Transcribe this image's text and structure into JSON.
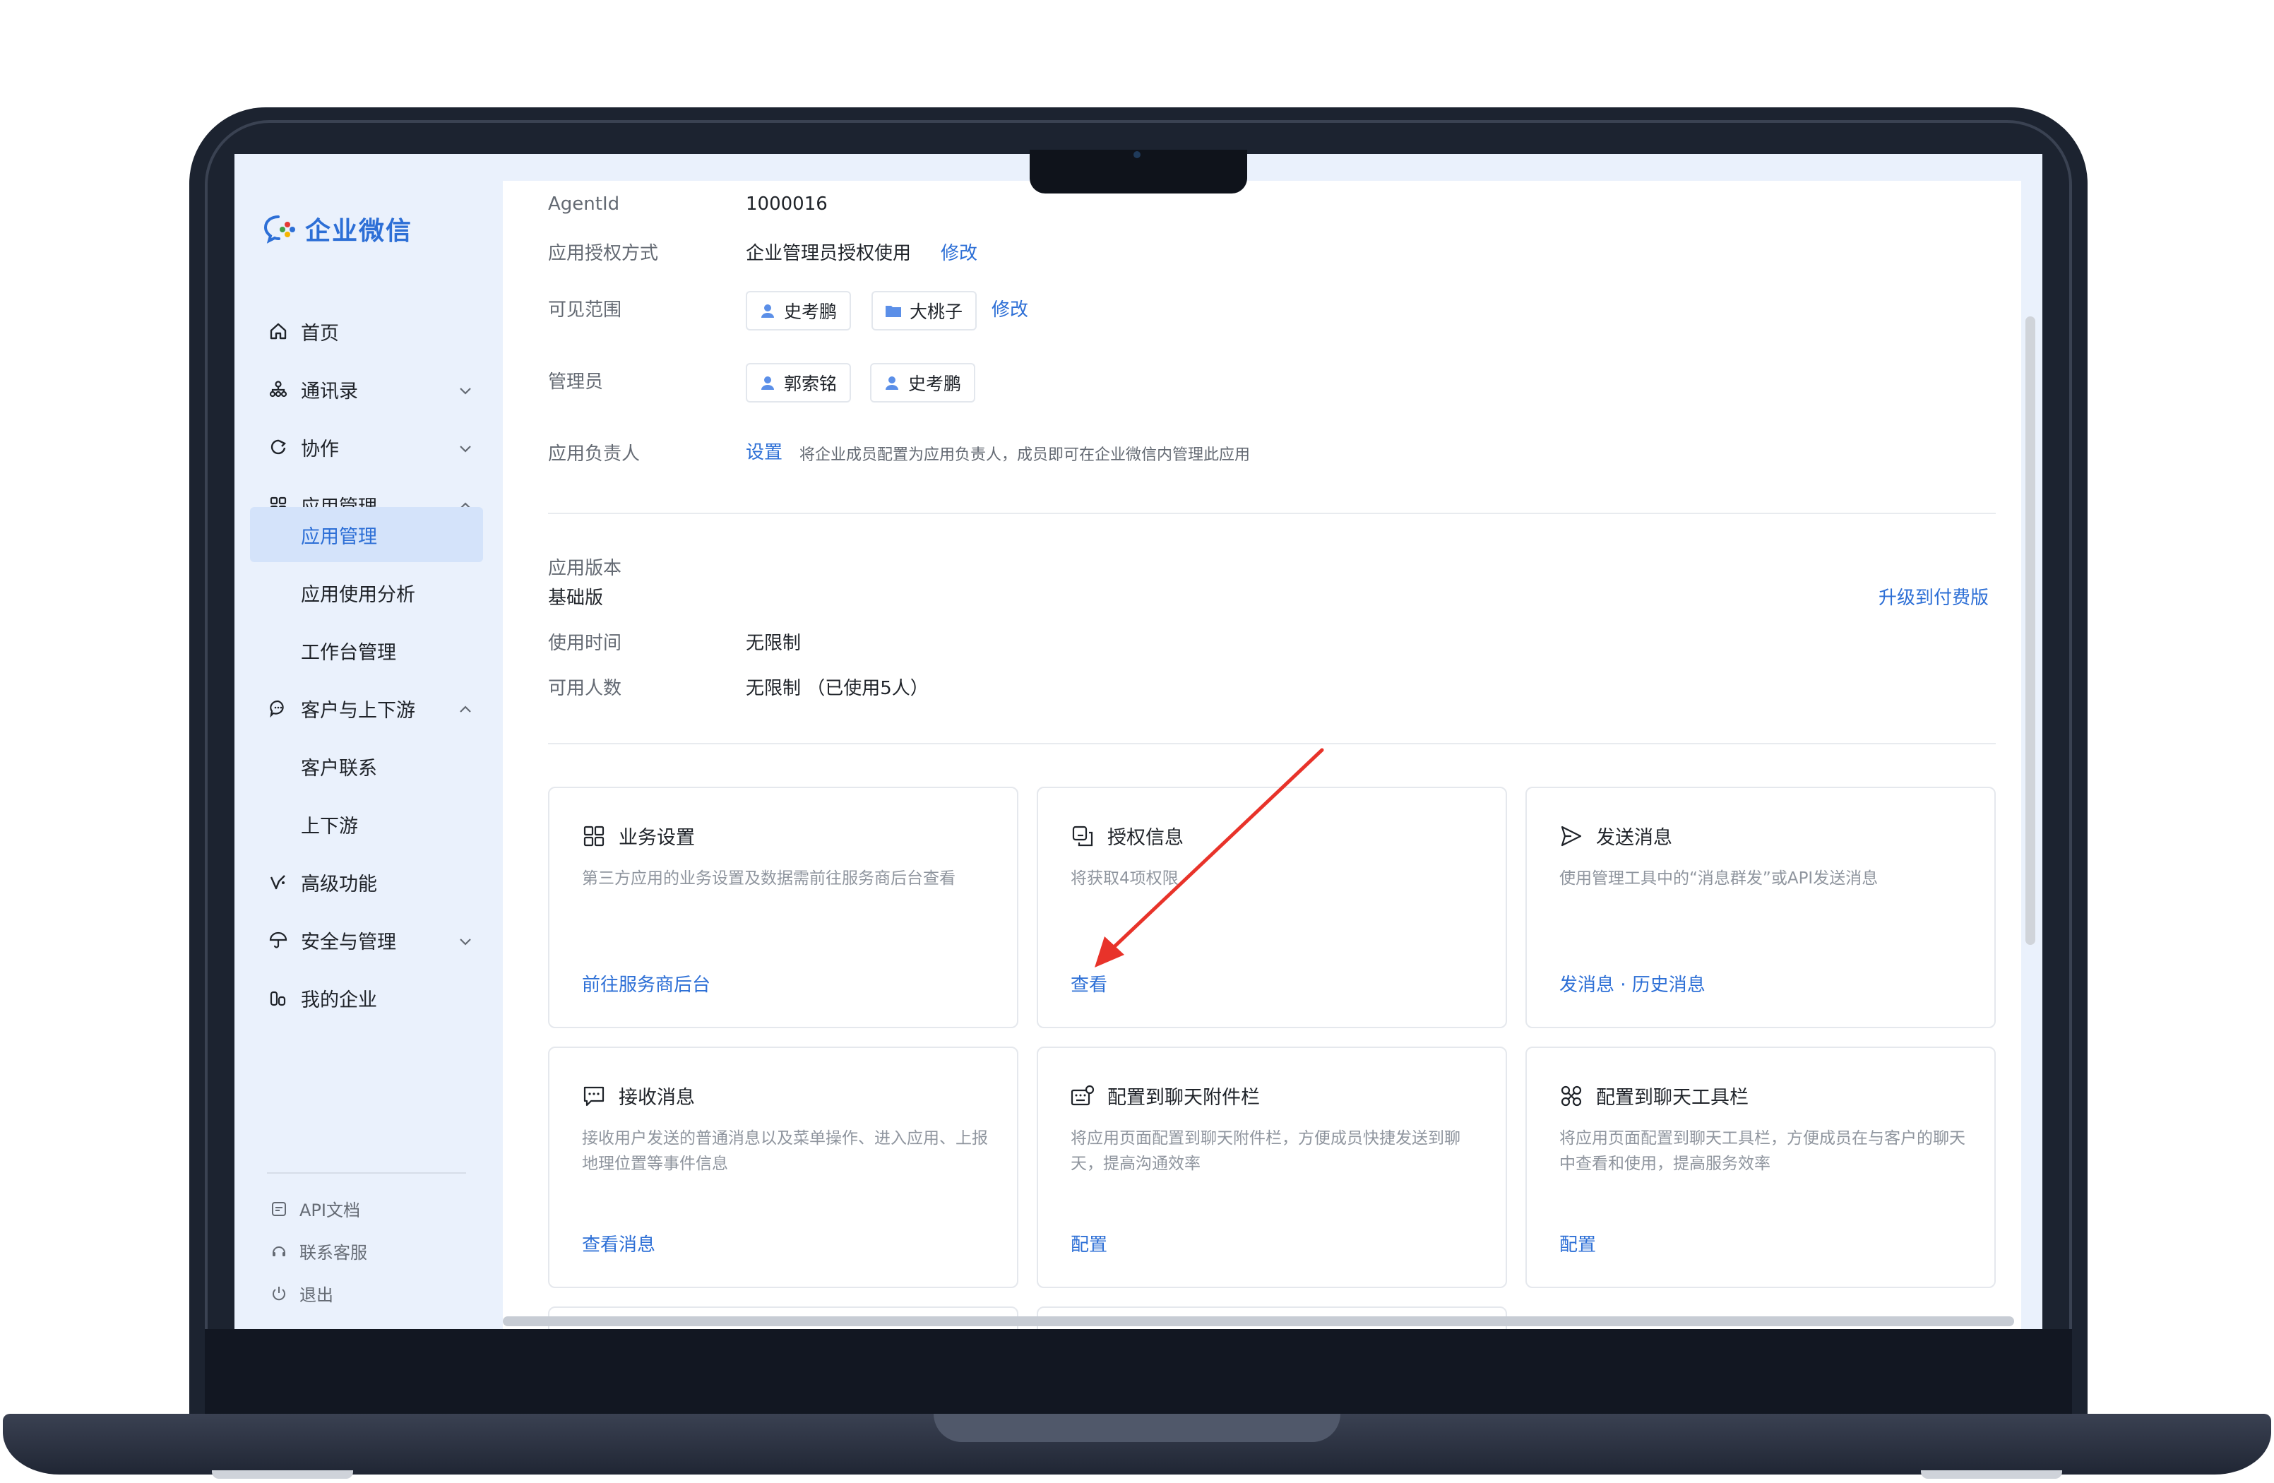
{
  "brand": {
    "name": "企业微信",
    "color": "#2d6fd6"
  },
  "sidebar": {
    "items": [
      {
        "label": "首页",
        "icon": "home-icon"
      },
      {
        "label": "通讯录",
        "icon": "org-chart-icon"
      },
      {
        "label": "协作",
        "icon": "collaboration-icon"
      },
      {
        "label": "应用管理",
        "icon": "apps-grid-icon"
      },
      {
        "label": "应用管理"
      },
      {
        "label": "应用使用分析"
      },
      {
        "label": "工作台管理"
      },
      {
        "label": "客户与上下游",
        "icon": "chat-bubble-icon"
      },
      {
        "label": "客户联系"
      },
      {
        "label": "上下游"
      },
      {
        "label": "高级功能",
        "icon": "advanced-icon"
      },
      {
        "label": "安全与管理",
        "icon": "umbrella-icon"
      },
      {
        "label": "我的企业",
        "icon": "company-icon"
      }
    ],
    "footer": [
      {
        "label": "API文档",
        "icon": "document-icon"
      },
      {
        "label": "联系客服",
        "icon": "headset-icon"
      },
      {
        "label": "退出",
        "icon": "power-icon"
      }
    ]
  },
  "app_info": {
    "agentid_label": "AgentId",
    "agentid_value": "1000016",
    "auth_label": "应用授权方式",
    "auth_value": "企业管理员授权使用",
    "edit": "修改",
    "scope_label": "可见范围",
    "scope_chips": [
      "史考鹏",
      "大桃子"
    ],
    "admin_label": "管理员",
    "admin_chips": [
      "郭索铭",
      "史考鹏"
    ],
    "owner_label": "应用负责人",
    "owner_set": "设置",
    "owner_hint": "将企业成员配置为应用负责人，成员即可在企业微信内管理此应用"
  },
  "version": {
    "label": "应用版本",
    "value": "基础版",
    "upgrade": "升级到付费版",
    "time_label": "使用时间",
    "time_value": "无限制",
    "users_label": "可用人数",
    "users_value": "无限制 （已使用5人）"
  },
  "cards": [
    {
      "title": "业务设置",
      "icon": "grid-icon",
      "desc": "第三方应用的业务设置及数据需前往服务商后台查看",
      "link": "前往服务商后台"
    },
    {
      "title": "授权信息",
      "icon": "copy-icon",
      "desc": "将获取4项权限",
      "link": "查看"
    },
    {
      "title": "发送消息",
      "icon": "send-icon",
      "desc": "使用管理工具中的“消息群发”或API发送消息",
      "link": "发消息 · 历史消息"
    },
    {
      "title": "接收消息",
      "icon": "message-icon",
      "desc": "接收用户发送的普通消息以及菜单操作、进入应用、上报地理位置等事件信息",
      "link": "查看消息"
    },
    {
      "title": "配置到聊天附件栏",
      "icon": "keyboard-settings-icon",
      "desc": "将应用页面配置到聊天附件栏，方便成员快捷发送到聊天，提高沟通效率",
      "link": "配置"
    },
    {
      "title": "配置到聊天工具栏",
      "icon": "tools-icon",
      "desc": "将应用页面配置到聊天工具栏，方便成员在与客户的聊天中查看和使用，提高服务效率",
      "link": "配置"
    }
  ],
  "annotation": {
    "arrow_color": "#e8332a"
  }
}
